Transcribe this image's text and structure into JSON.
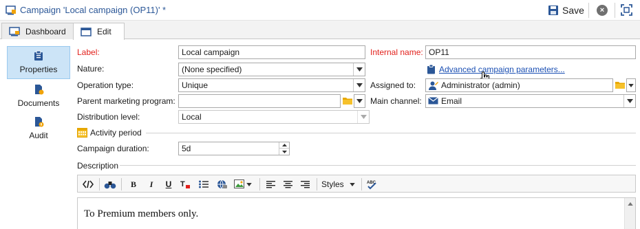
{
  "window": {
    "title": "Campaign 'Local campaign (OP11)' *"
  },
  "toolbar": {
    "save_label": "Save"
  },
  "tabs": [
    {
      "label": "Dashboard"
    },
    {
      "label": "Edit"
    }
  ],
  "nav": [
    {
      "label": "Properties"
    },
    {
      "label": "Documents"
    },
    {
      "label": "Audit"
    }
  ],
  "form": {
    "label": {
      "label": "Label:",
      "value": "Local campaign"
    },
    "internal_name": {
      "label": "Internal name:",
      "value": "OP11"
    },
    "nature": {
      "label": "Nature:",
      "value": "(None specified)"
    },
    "advanced_link": "Advanced campaign parameters...",
    "operation_type": {
      "label": "Operation type:",
      "value": "Unique"
    },
    "assigned_to": {
      "label": "Assigned to:",
      "value": "Administrator (admin)"
    },
    "parent_program": {
      "label": "Parent marketing program:",
      "value": ""
    },
    "main_channel": {
      "label": "Main channel:",
      "value": "Email"
    },
    "distribution_level": {
      "label": "Distribution level:",
      "value": "Local"
    },
    "activity_period": "Activity period",
    "campaign_duration": {
      "label": "Campaign duration:",
      "value": "5d"
    },
    "description": "Description"
  },
  "rte": {
    "styles_label": "Styles",
    "content": "To Premium members only."
  },
  "colors": {
    "accent": "#2b5797",
    "required": "#e2211c",
    "selected_nav": "#cce4f7"
  }
}
